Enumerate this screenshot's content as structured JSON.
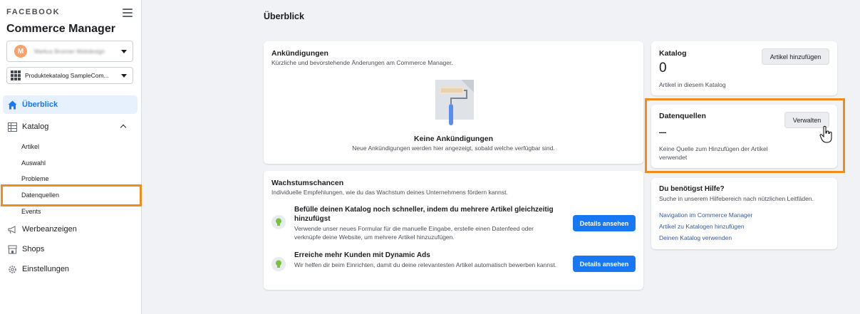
{
  "sidebar": {
    "brand": "FACEBOOK",
    "app_title": "Commerce Manager",
    "business_select": {
      "avatar_initial": "M",
      "value": "Markus Brunner Webdesign"
    },
    "catalog_select": {
      "value": "Produktekatalog SampleCom..."
    },
    "nav": {
      "overview": "Überblick",
      "catalog": "Katalog",
      "catalog_items": [
        "Artikel",
        "Auswahl",
        "Probleme",
        "Datenquellen",
        "Events"
      ],
      "ads": "Werbeanzeigen",
      "shops": "Shops",
      "settings": "Einstellungen"
    }
  },
  "main": {
    "page_title": "Überblick",
    "announcements": {
      "title": "Ankündigungen",
      "subtitle": "Kürzliche und bevorstehende Änderungen am Commerce Manager.",
      "empty_title": "Keine Ankündigungen",
      "empty_subtitle": "Neue Ankündigungen werden hier angezeigt, sobald welche verfügbar sind."
    },
    "growth": {
      "title": "Wachstumschancen",
      "subtitle": "Individuelle Empfehlungen, wie du das Wachstum deines Unternehmens fördern kannst.",
      "items": [
        {
          "title": "Befülle deinen Katalog noch schneller, indem du mehrere Artikel gleichzeitig hinzufügst",
          "desc": "Verwende unser neues Formular für die manuelle Eingabe, erstelle einen Datenfeed oder verknüpfe deine Website, um mehrere Artikel hinzuzufügen.",
          "button": "Details ansehen"
        },
        {
          "title": "Erreiche mehr Kunden mit Dynamic Ads",
          "desc": "Wir helfen dir beim Einrichten, damit du deine relevantesten Artikel automatisch bewerben kannst.",
          "button": "Details ansehen"
        }
      ]
    },
    "catalog": {
      "title": "Katalog",
      "count": "0",
      "caption": "Artikel in diesem Katalog",
      "button": "Artikel hinzufügen"
    },
    "datasources": {
      "title": "Datenquellen",
      "value": "–",
      "caption": "Keine Quelle zum Hinzufügen der Artikel verwendet",
      "button": "Verwalten"
    },
    "help": {
      "title": "Du benötigst Hilfe?",
      "subtitle": "Suche in unserem Hilfebereich nach nützlichen Leitfäden.",
      "links": [
        "Navigation im Commerce Manager",
        "Artikel zu Katalogen hinzufügen",
        "Deinen Katalog verwenden"
      ]
    }
  },
  "colors": {
    "accent": "#1877f2",
    "highlight": "#f08c1a"
  }
}
